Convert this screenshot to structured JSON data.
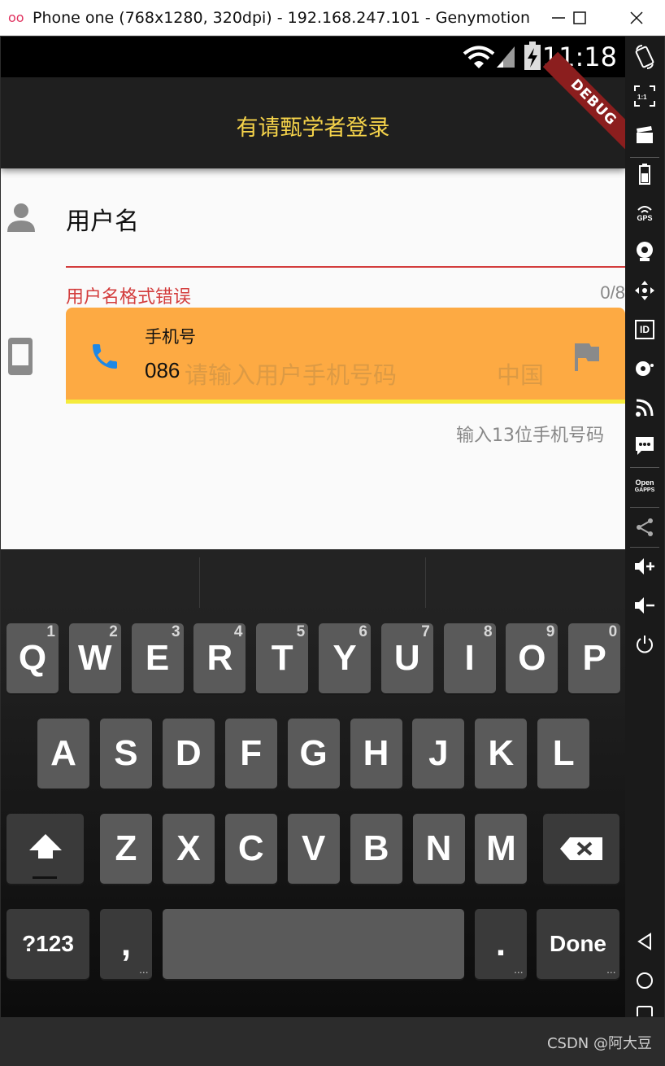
{
  "window": {
    "logo": "oo",
    "title": "Phone one (768x1280, 320dpi) - 192.168.247.101 - Genymotion"
  },
  "status_bar": {
    "time": "11:18"
  },
  "app_bar": {
    "title": "有请甄学者登录",
    "ribbon": "DEBUG"
  },
  "form": {
    "username": {
      "label": "用户名",
      "error": "用户名格式错误",
      "counter": "0/8"
    },
    "phone": {
      "label": "手机号",
      "prefix": "086",
      "hint": "请输入用户手机号码",
      "suffix": "中国",
      "helper": "输入13位手机号码"
    }
  },
  "keyboard": {
    "row1": [
      {
        "key": "Q",
        "num": "1"
      },
      {
        "key": "W",
        "num": "2"
      },
      {
        "key": "E",
        "num": "3"
      },
      {
        "key": "R",
        "num": "4"
      },
      {
        "key": "T",
        "num": "5"
      },
      {
        "key": "Y",
        "num": "6"
      },
      {
        "key": "U",
        "num": "7"
      },
      {
        "key": "I",
        "num": "8"
      },
      {
        "key": "O",
        "num": "9"
      },
      {
        "key": "P",
        "num": "0"
      }
    ],
    "row2": [
      "A",
      "S",
      "D",
      "F",
      "G",
      "H",
      "J",
      "K",
      "L"
    ],
    "row3": [
      "Z",
      "X",
      "C",
      "V",
      "B",
      "N",
      "M"
    ],
    "symbols_label": "?123",
    "comma_label": ",",
    "period_label": ".",
    "done_label": "Done",
    "more_dots": "..."
  },
  "sidebar": {
    "gps_label": "GPS",
    "id_label": "ID",
    "open_label": "Open",
    "gapps_label": "GAPPS",
    "scale_label": "1:1"
  },
  "watermark": "CSDN @阿大豆",
  "colors": {
    "appbar_title": "#f5d34a",
    "error": "#d33d3d",
    "phone_field_bg": "#fdaa43",
    "phone_field_underline": "#f5eb3c",
    "phone_icon": "#1e88e5"
  }
}
